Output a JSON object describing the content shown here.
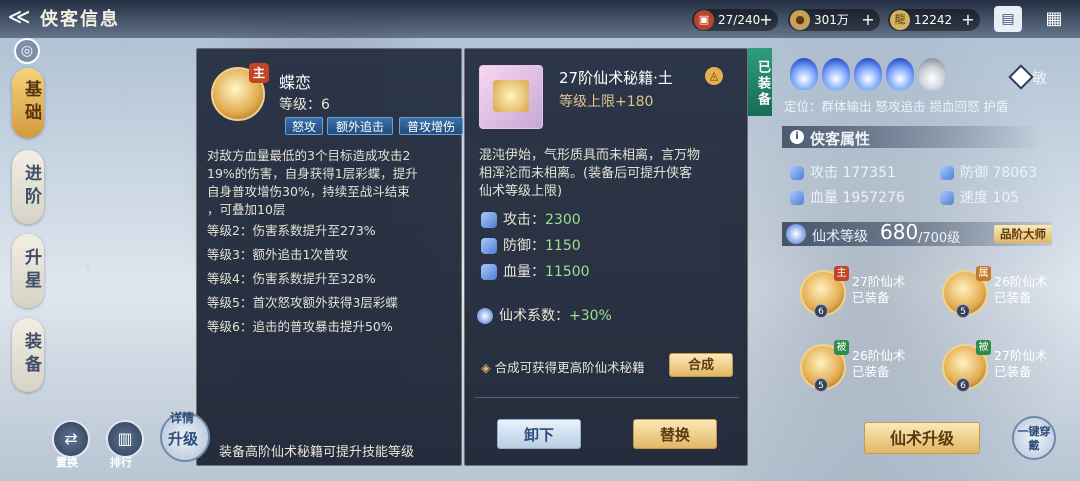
{
  "header": {
    "title": "侠客信息",
    "back_icon": "back-arrow-icon",
    "resources": [
      {
        "icon": "chest-icon",
        "value": "27/240"
      },
      {
        "icon": "coin-icon",
        "value": "301万"
      },
      {
        "icon": "dragon-token-icon",
        "value": "12242"
      }
    ]
  },
  "tabs": [
    {
      "label": "基础",
      "active": true
    },
    {
      "label": "进阶"
    },
    {
      "label": "升星"
    },
    {
      "label": "装备"
    }
  ],
  "skill": {
    "badge": "主",
    "name": "蝶恋",
    "level": "等级：6",
    "tags": [
      "怒攻",
      "额外追击",
      "普攻增伤"
    ],
    "desc": [
      "对敌方血量最低的3个目标造成攻击2",
      "19%的伤害，自身获得1层彩蝶，提升",
      "自身普攻增伤30%，持续至战斗结束",
      "，可叠加10层"
    ],
    "levels": [
      "等级2：伤害系数提升至273%",
      "等级3：额外追击1次普攻",
      "等级4：伤害系数提升至328%",
      "等级5：首次怒攻额外获得3层彩蝶",
      "等级6：追击的普攻暴击提升50%"
    ],
    "footer": "装备高阶仙术秘籍可提升技能等级"
  },
  "book": {
    "name": "27阶仙术秘籍·土",
    "element": "土",
    "level_cap": "等级上限+180",
    "equipped": "已装备",
    "desc": [
      "混沌伊始，气形质具而未相离，言万物",
      "相浑沦而未相离。(装备后可提升侠客",
      "仙术等级上限)"
    ],
    "stats": [
      {
        "label": "攻击：",
        "value": "2300"
      },
      {
        "label": "防御：",
        "value": "1150"
      },
      {
        "label": "血量：",
        "value": "11500"
      }
    ],
    "coef_label": "仙术系数：",
    "coef_value": "+30%",
    "hint": "合成可获得更高阶仙术秘籍",
    "compose": "合成",
    "unequip": "卸下",
    "replace": "替换"
  },
  "right": {
    "element_symbol": "敏",
    "role": "定位：群体输出 怒攻追击 损血回怒 护盾",
    "attr_title": "侠客属性",
    "attrs": [
      {
        "label": "攻击",
        "value": "177351"
      },
      {
        "label": "防御",
        "value": "78063"
      },
      {
        "label": "血量",
        "value": "1957276"
      },
      {
        "label": "速度",
        "value": "105"
      }
    ],
    "level_label": "仙术等级",
    "level_value": "680",
    "level_max": "/700级",
    "grade": "品阶大师",
    "slots": [
      {
        "badge": "主",
        "name": "27阶仙术",
        "state": "已装备",
        "lv": "6"
      },
      {
        "badge": "属",
        "name": "26阶仙术",
        "state": "已装备",
        "lv": "5"
      },
      {
        "badge": "被",
        "name": "26阶仙术",
        "state": "已装备",
        "lv": "5"
      },
      {
        "badge": "被",
        "name": "27阶仙术",
        "state": "已装备",
        "lv": "6"
      }
    ],
    "upgrade": "仙术升级",
    "onekey": "一键穿戴"
  },
  "bottom": {
    "items": [
      {
        "label": "置换",
        "icon": "swap-icon"
      },
      {
        "label": "排行",
        "icon": "rank-icon"
      }
    ],
    "detail": "详情",
    "upgrade": "升级"
  },
  "colors": {
    "gold": "#e2b764",
    "blue": "#3a6fa8",
    "green_value": "#9ee08f"
  }
}
